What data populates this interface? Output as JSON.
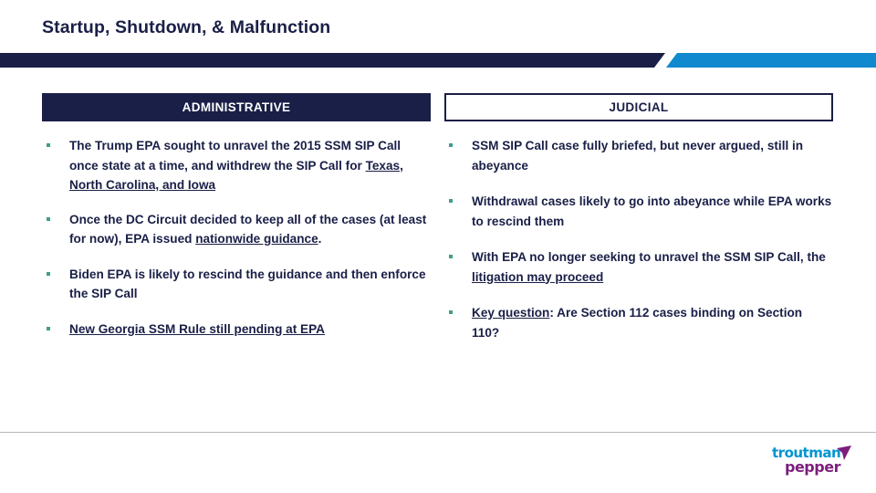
{
  "slide": {
    "title": "Startup, Shutdown, & Malfunction",
    "colors": {
      "navy": "#1a1f47",
      "accent_blue": "#1089ce",
      "bullet_teal": "#3f9e8c",
      "rule_gray": "#b6b6b6",
      "logo_cyan": "#0094d2",
      "logo_purple": "#7c1f7c"
    }
  },
  "columns": {
    "left": {
      "heading": "ADMINISTRATIVE",
      "bullets": [
        {
          "segments": [
            {
              "text": "The Trump EPA sought to unravel the 2015 SSM SIP Call once state at a time, and withdrew the SIP Call for ",
              "underline": false
            },
            {
              "text": "Texas, North Carolina, and Iowa",
              "underline": true
            }
          ]
        },
        {
          "segments": [
            {
              "text": "Once the DC Circuit decided to keep all of the cases (at least for now), EPA issued ",
              "underline": false
            },
            {
              "text": "nationwide guidance",
              "underline": true
            },
            {
              "text": ".",
              "underline": false
            }
          ]
        },
        {
          "segments": [
            {
              "text": "Biden EPA is likely to rescind the guidance and then enforce the SIP Call",
              "underline": false
            }
          ]
        },
        {
          "segments": [
            {
              "text": "New Georgia SSM Rule still pending at EPA",
              "underline": true
            }
          ]
        }
      ]
    },
    "right": {
      "heading": "JUDICIAL",
      "bullets": [
        {
          "segments": [
            {
              "text": "SSM SIP Call case fully briefed, but never argued, still in abeyance",
              "underline": false
            }
          ]
        },
        {
          "segments": [
            {
              "text": "Withdrawal cases likely to go into abeyance while EPA works to rescind them",
              "underline": false
            }
          ]
        },
        {
          "segments": [
            {
              "text": "With EPA no longer seeking to unravel the SSM SIP Call, the ",
              "underline": false
            },
            {
              "text": "litigation may proceed",
              "underline": true
            }
          ]
        },
        {
          "segments": [
            {
              "text": "Key question",
              "underline": true
            },
            {
              "text": ": Are Section 112 cases binding on Section 110?",
              "underline": false
            }
          ]
        }
      ]
    }
  },
  "footer": {
    "logo": {
      "word_one": "troutman",
      "word_two": "pepper"
    }
  }
}
